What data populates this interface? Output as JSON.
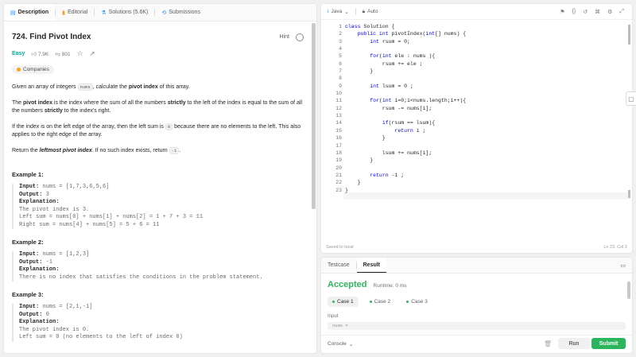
{
  "left_tabs": [
    {
      "label": "Description",
      "icon": "doc-icon"
    },
    {
      "label": "Editorial",
      "icon": "book-icon"
    },
    {
      "label": "Solutions (5.6K)",
      "icon": "flask-icon"
    },
    {
      "label": "Submissions",
      "icon": "history-icon"
    }
  ],
  "problem": {
    "title": "724. Find Pivot Index",
    "hint": "Hint",
    "difficulty": "Easy",
    "likes": "7.9K",
    "dislikes": "801",
    "companies": "Companies",
    "p1_a": "Given an array of integers ",
    "p1_code": "nums",
    "p1_b": ", calculate the ",
    "p1_bold": "pivot index",
    "p1_c": " of this array.",
    "p2_a": "The ",
    "p2_bold1": "pivot index",
    "p2_b": " is the index where the sum of all the numbers ",
    "p2_bold2": "strictly",
    "p2_c": " to the left of the index is equal to the sum of all the numbers ",
    "p2_bold3": "strictly",
    "p2_d": " to the index's right.",
    "p3_a": "If the index is on the left edge of the array, then the left sum is ",
    "p3_code": "0",
    "p3_b": " because there are no elements to the left. This also applies to the right edge of the array.",
    "p4_a": "Return the ",
    "p4_bold": "leftmost pivot index",
    "p4_b": ". If no such index exists, return ",
    "p4_code": "-1",
    "p4_c": "."
  },
  "examples": [
    {
      "heading": "Example 1:",
      "input_label": "Input:",
      "input": "nums = [1,7,3,6,5,6]",
      "output_label": "Output:",
      "output": "3",
      "explanation_label": "Explanation:",
      "explanation": [
        "The pivot index is 3.",
        "Left sum = nums[0] + nums[1] + nums[2] = 1 + 7 + 3 = 11",
        "Right sum = nums[4] + nums[5] = 5 + 6 = 11"
      ]
    },
    {
      "heading": "Example 2:",
      "input_label": "Input:",
      "input": "nums = [1,2,3]",
      "output_label": "Output:",
      "output": "-1",
      "explanation_label": "Explanation:",
      "explanation": [
        "There is no index that satisfies the conditions in the problem statement."
      ]
    },
    {
      "heading": "Example 3:",
      "input_label": "Input:",
      "input": "nums = [2,1,-1]",
      "output_label": "Output:",
      "output": "0",
      "explanation_label": "Explanation:",
      "explanation": [
        "The pivot index is 0.",
        "Left sum = 0 (no elements to the left of index 0)"
      ]
    }
  ],
  "editor": {
    "language": "Java",
    "mode": "Auto",
    "saved": "Saved to local",
    "cursor": "Ln 23, Col 2",
    "lines": [
      "class Solution {",
      "    public int pivotIndex(int[] nums) {",
      "        int rsum = 0;",
      "",
      "        for(int ele : nums ){",
      "            rsum += ele ;",
      "        }",
      "",
      "        int lsum = 0 ;",
      "",
      "        for(int i=0;i<nums.length;i++){",
      "            rsum -= nums[i];",
      "",
      "            if(rsum == lsum){",
      "                return i ;",
      "            }",
      "",
      "            lsum += nums[i];",
      "        }",
      "",
      "        return -1 ;",
      "    }",
      "}"
    ]
  },
  "bottom": {
    "tabs": [
      "Testcase",
      "Result"
    ],
    "status": "Accepted",
    "runtime": "Runtime: 0 ms",
    "cases": [
      "Case 1",
      "Case 2",
      "Case 3"
    ],
    "input_label": "Input",
    "input_preview": "nums =",
    "console": "Console",
    "run": "Run",
    "submit": "Submit"
  },
  "colors": {
    "easy": "#00af9b",
    "accepted": "#2db55d",
    "submit": "#2db55d",
    "brand": "#ffa116"
  }
}
